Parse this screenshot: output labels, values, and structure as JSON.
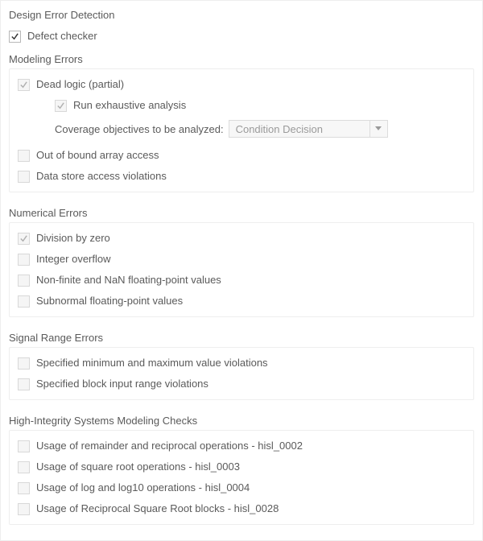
{
  "title": "Design Error Detection",
  "defect_checker": {
    "label": "Defect checker",
    "checked": true,
    "enabled": true
  },
  "sections": {
    "modeling": {
      "title": "Modeling Errors",
      "dead_logic": {
        "label": "Dead logic (partial)",
        "checked": true,
        "enabled": false,
        "run_exhaustive": {
          "label": "Run exhaustive analysis",
          "checked": true,
          "enabled": false
        },
        "coverage": {
          "label": "Coverage objectives to be analyzed:",
          "value": "Condition Decision",
          "enabled": false
        }
      },
      "out_of_bound": {
        "label": "Out of bound array access",
        "checked": false,
        "enabled": false
      },
      "data_store": {
        "label": "Data store access violations",
        "checked": false,
        "enabled": false
      }
    },
    "numerical": {
      "title": "Numerical Errors",
      "division_by_zero": {
        "label": "Division by zero",
        "checked": true,
        "enabled": false
      },
      "integer_overflow": {
        "label": "Integer overflow",
        "checked": false,
        "enabled": false
      },
      "nonfinite": {
        "label": "Non-finite and NaN floating-point values",
        "checked": false,
        "enabled": false
      },
      "subnormal": {
        "label": "Subnormal floating-point values",
        "checked": false,
        "enabled": false
      }
    },
    "signal_range": {
      "title": "Signal Range Errors",
      "minmax": {
        "label": "Specified minimum and maximum value violations",
        "checked": false,
        "enabled": false
      },
      "blockin": {
        "label": "Specified block input range violations",
        "checked": false,
        "enabled": false
      }
    },
    "hism": {
      "title": "High-Integrity Systems Modeling Checks",
      "hisl_0002": {
        "label": "Usage of remainder and reciprocal operations - hisl_0002",
        "checked": false,
        "enabled": false
      },
      "hisl_0003": {
        "label": "Usage of square root operations - hisl_0003",
        "checked": false,
        "enabled": false
      },
      "hisl_0004": {
        "label": "Usage of log and log10 operations - hisl_0004",
        "checked": false,
        "enabled": false
      },
      "hisl_0028": {
        "label": "Usage of Reciprocal Square Root blocks - hisl_0028",
        "checked": false,
        "enabled": false
      }
    }
  }
}
